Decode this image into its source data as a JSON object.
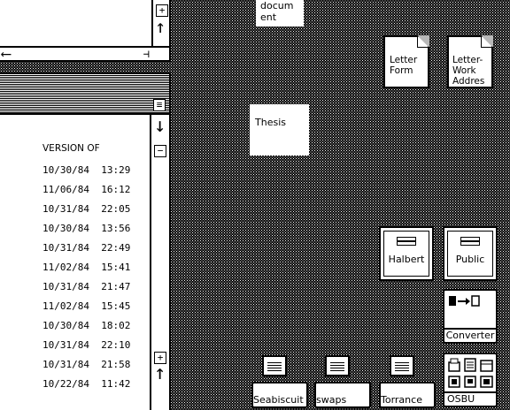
{
  "top_window": {
    "scroll_up": "+",
    "arrow_up": "↑",
    "arrow_left": "⟵",
    "page_right": "⊣"
  },
  "document_window_label": [
    "docum",
    "ent"
  ],
  "list_window": {
    "menu_icon": "≡",
    "header": "VERSION OF",
    "rows": [
      "10/30/84  13:29",
      "11/06/84  16:12",
      "10/31/84  22:05",
      "10/30/84  13:56",
      "10/31/84  22:49",
      "11/02/84  15:41",
      "10/31/84  21:47",
      "11/02/84  15:45",
      "10/30/84  18:02",
      "10/31/84  22:10",
      "10/31/84  21:58",
      "10/22/84  11:42"
    ],
    "scroll_down": "↓",
    "scroll_minus": "−",
    "scroll_plus": "+",
    "scroll_up": "↑"
  },
  "desktop": {
    "letter_form": [
      "Letter",
      "Form"
    ],
    "letter_work": [
      "Letter-",
      "Work",
      "Addres"
    ],
    "thesis": "Thesis",
    "halbert": "Halbert",
    "public": "Public",
    "converter": "Converter",
    "osbu": "OSBU",
    "printers": [
      "Seabiscuit",
      "swaps",
      "Torrance"
    ]
  }
}
